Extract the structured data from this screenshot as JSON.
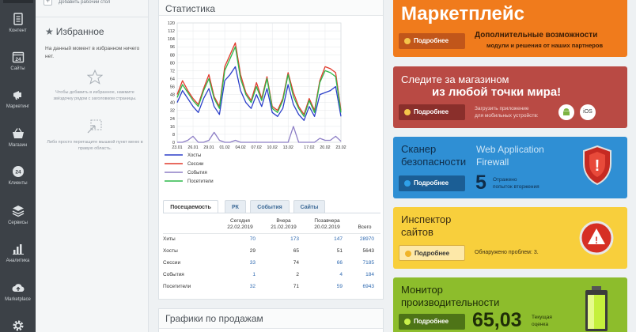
{
  "nav": [
    {
      "id": "content",
      "label": "Контент",
      "icon": "document-icon"
    },
    {
      "id": "sites",
      "label": "Сайты",
      "icon": "calendar-24-icon"
    },
    {
      "id": "marketing",
      "label": "Маркетинг",
      "icon": "megaphone-icon"
    },
    {
      "id": "shop",
      "label": "Магазин",
      "icon": "basket-icon"
    },
    {
      "id": "clients",
      "label": "Клиенты",
      "icon": "clients-24-icon"
    },
    {
      "id": "services",
      "label": "Сервисы",
      "icon": "layers-icon"
    },
    {
      "id": "analytics",
      "label": "Аналитика",
      "icon": "bar-chart-icon"
    },
    {
      "id": "marketplace",
      "label": "Marketplace",
      "icon": "cloud-upload-icon"
    }
  ],
  "favorites": {
    "add_desktop": "Добавить рабочий стол",
    "title": "Избранное",
    "empty_text": "На данный момент в избранном ничего нет.",
    "hint_star": "Чтобы добавить в избранное, нажмите звёздочку рядом с заголовком страницы.",
    "hint_drag": "Либо просто перетащите мышкой пункт меню в правую область."
  },
  "stats": {
    "title": "Статистика",
    "tabs": [
      "Посещаемость",
      "РК",
      "События",
      "Сайты"
    ],
    "table": {
      "headers": [
        {
          "line1": "",
          "line2": ""
        },
        {
          "line1": "Сегодня",
          "line2": "22.02.2019"
        },
        {
          "line1": "Вчера",
          "line2": "21.02.2019"
        },
        {
          "line1": "Позавчера",
          "line2": "20.02.2019"
        },
        {
          "line1": "Всего",
          "line2": ""
        }
      ],
      "rows": [
        {
          "label": "Хиты",
          "values": [
            "70",
            "173",
            "147",
            "28970"
          ],
          "links": [
            true,
            true,
            true,
            true
          ]
        },
        {
          "label": "Хосты",
          "values": [
            "29",
            "65",
            "51",
            "5643"
          ],
          "links": [
            false,
            false,
            false,
            false
          ]
        },
        {
          "label": "Сессии",
          "values": [
            "33",
            "74",
            "66",
            "7185"
          ],
          "links": [
            true,
            false,
            true,
            true
          ]
        },
        {
          "label": "События",
          "values": [
            "1",
            "2",
            "4",
            "184"
          ],
          "links": [
            true,
            false,
            true,
            true
          ]
        },
        {
          "label": "Посетители",
          "values": [
            "32",
            "71",
            "59",
            "6943"
          ],
          "links": [
            true,
            false,
            true,
            true
          ]
        }
      ]
    }
  },
  "chart_data": {
    "type": "line",
    "x": [
      "23.01",
      "24.01",
      "25.01",
      "26.01",
      "27.01",
      "28.01",
      "29.01",
      "30.01",
      "31.01",
      "01.02",
      "02.02",
      "03.02",
      "04.02",
      "05.02",
      "06.02",
      "07.02",
      "08.02",
      "09.02",
      "10.02",
      "11.02",
      "12.02",
      "13.02",
      "14.02",
      "15.02",
      "16.02",
      "17.02",
      "18.02",
      "19.02",
      "20.02",
      "21.02",
      "22.02",
      "23.02"
    ],
    "x_tick_labels": [
      "23.01",
      "26.01",
      "29.01",
      "01.02",
      "04.02",
      "07.02",
      "10.02",
      "13.02",
      "17.02",
      "20.02",
      "23.02"
    ],
    "ylim": [
      0,
      120
    ],
    "y_ticks": [
      0,
      8,
      16,
      24,
      32,
      40,
      48,
      56,
      64,
      72,
      80,
      88,
      96,
      104,
      112,
      120
    ],
    "series": [
      {
        "name": "Хосты",
        "color": "#2b3fc9",
        "values": [
          40,
          52,
          44,
          36,
          30,
          44,
          54,
          36,
          28,
          62,
          68,
          76,
          52,
          40,
          34,
          48,
          36,
          54,
          30,
          26,
          34,
          58,
          38,
          28,
          22,
          36,
          26,
          48,
          50,
          52,
          56,
          26
        ]
      },
      {
        "name": "Сессии",
        "color": "#e03a2c",
        "values": [
          48,
          62,
          52,
          44,
          38,
          54,
          68,
          46,
          36,
          76,
          88,
          100,
          68,
          50,
          42,
          60,
          44,
          66,
          36,
          32,
          44,
          70,
          50,
          36,
          28,
          44,
          32,
          62,
          76,
          74,
          70,
          32
        ]
      },
      {
        "name": "События",
        "color": "#8e7fc6",
        "values": [
          0,
          0,
          2,
          6,
          0,
          0,
          2,
          10,
          2,
          0,
          0,
          2,
          0,
          0,
          0,
          0,
          0,
          0,
          0,
          0,
          0,
          0,
          16,
          0,
          0,
          0,
          0,
          4,
          2,
          2,
          6,
          1
        ]
      },
      {
        "name": "Посетители",
        "color": "#2db84a",
        "values": [
          45,
          58,
          50,
          42,
          36,
          52,
          64,
          44,
          34,
          72,
          84,
          96,
          64,
          48,
          40,
          56,
          42,
          64,
          34,
          30,
          42,
          68,
          46,
          34,
          26,
          42,
          30,
          60,
          72,
          70,
          66,
          30
        ]
      }
    ]
  },
  "sales": {
    "title": "Графики по продажам"
  },
  "banners": {
    "marketplace": {
      "title": "Маркетплейс",
      "button": "Подробнее",
      "desc1": "Дополнительные возможности",
      "desc2": "модули и решения от наших партнеров",
      "bg": "#f07b1c"
    },
    "mobile": {
      "line1": "Следите за магазином",
      "line2": "из любой точки мира!",
      "button": "Подробнее",
      "desc1": "Загрузить приложение",
      "desc2": "для мобильных устройств:",
      "ios": "iOS",
      "bg": "#b94a44"
    },
    "scanner": {
      "title1": "Сканер",
      "title2": "безопасности",
      "waf1": "Web Application",
      "waf2": "Firewall",
      "button": "Подробнее",
      "count": "5",
      "note1": "Отражено",
      "note2": "попыток вторжения",
      "bg": "#2f8fd4"
    },
    "inspector": {
      "title1": "Инспектор",
      "title2": "сайтов",
      "button": "Подробнее",
      "note": "Обнаружено проблем: 3.",
      "bg": "#f8cf3c"
    },
    "monitor": {
      "title1": "Монитор",
      "title2": "производительности",
      "button": "Подробнее",
      "score": "65,03",
      "note1": "Текущая",
      "note2": "оценка",
      "bg": "#8dbd2c"
    }
  }
}
